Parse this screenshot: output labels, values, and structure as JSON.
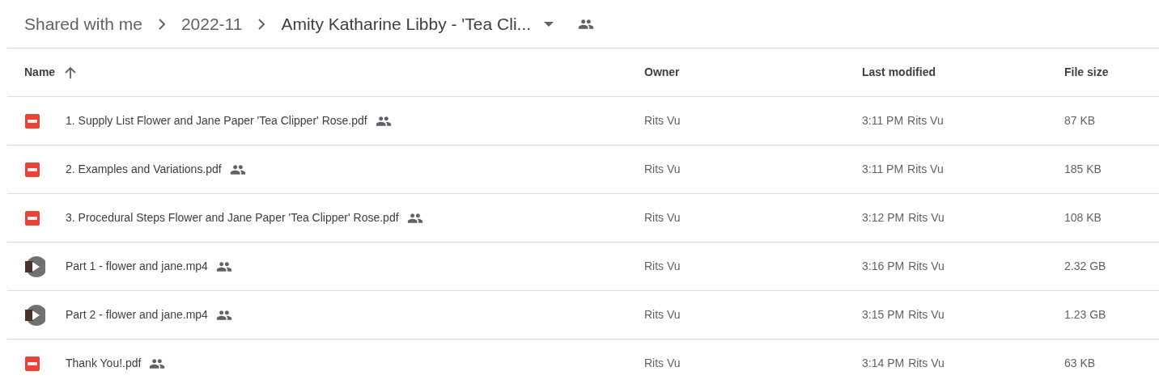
{
  "breadcrumb": [
    "Shared with me",
    "2022-11",
    "Amity Katharine Libby - 'Tea Cli..."
  ],
  "table": {
    "columns": [
      {
        "label": "Name",
        "sorted": true
      },
      {
        "label": "Owner",
        "sorted": false
      },
      {
        "label": "Last modified",
        "sorted": false
      },
      {
        "label": "File size",
        "sorted": false
      }
    ],
    "rows": [
      {
        "kind": "pdf",
        "name": "1. Supply List Flower and Jane Paper 'Tea Clipper' Rose.pdf",
        "owner": "Rits Vu",
        "time": "3:11 PM",
        "modified_by": "Rits Vu",
        "size": "87 KB"
      },
      {
        "kind": "pdf",
        "name": "2. Examples and Variations.pdf",
        "owner": "Rits Vu",
        "time": "3:11 PM",
        "modified_by": "Rits Vu",
        "size": "185 KB"
      },
      {
        "kind": "pdf",
        "name": "3. Procedural Steps Flower and Jane Paper 'Tea Clipper' Rose.pdf",
        "owner": "Rits Vu",
        "time": "3:12 PM",
        "modified_by": "Rits Vu",
        "size": "108 KB"
      },
      {
        "kind": "video",
        "name": "Part 1 - flower and jane.mp4",
        "owner": "Rits Vu",
        "time": "3:16 PM",
        "modified_by": "Rits Vu",
        "size": "2.32 GB"
      },
      {
        "kind": "video",
        "name": "Part 2 - flower and jane.mp4",
        "owner": "Rits Vu",
        "time": "3:15 PM",
        "modified_by": "Rits Vu",
        "size": "1.23 GB"
      },
      {
        "kind": "pdf",
        "name": "Thank You!.pdf",
        "owner": "Rits Vu",
        "time": "3:14 PM",
        "modified_by": "Rits Vu",
        "size": "63 KB"
      }
    ]
  }
}
